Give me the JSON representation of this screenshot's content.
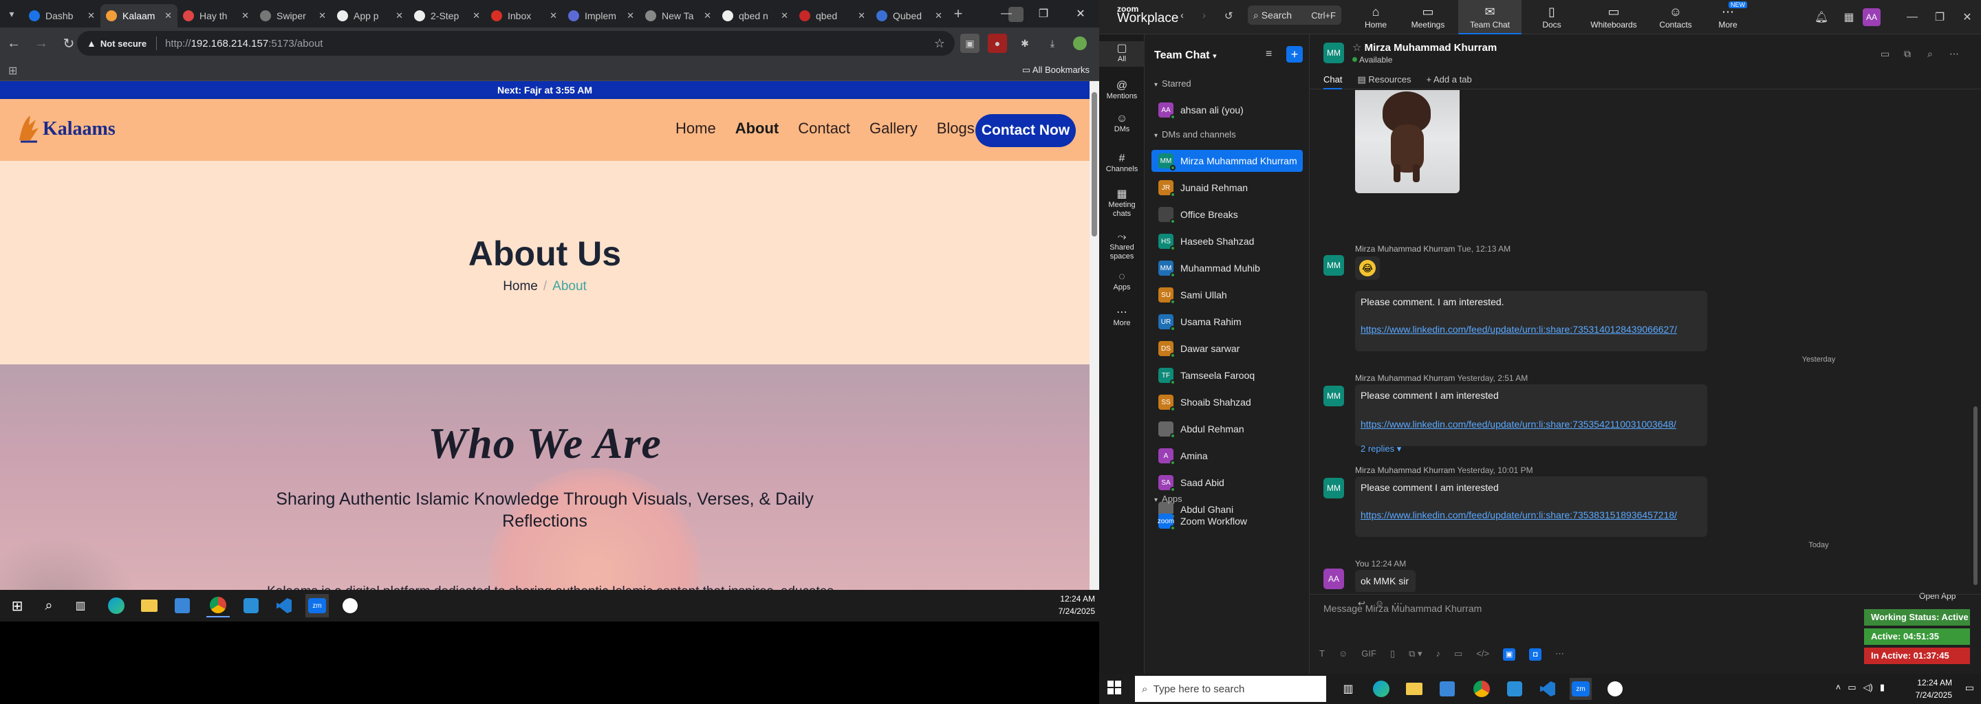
{
  "chrome": {
    "tabs": [
      {
        "label": "Dashb",
        "color": "#1a73e8"
      },
      {
        "label": "Kalaam",
        "color": "#f29d38",
        "active": true
      },
      {
        "label": "Hay th",
        "color": "#e04545"
      },
      {
        "label": "Swiper",
        "color": "#777777"
      },
      {
        "label": "App p",
        "color": "#eeeeee"
      },
      {
        "label": "2-Step",
        "color": "#eeeeee"
      },
      {
        "label": "Inbox",
        "color": "#d93025"
      },
      {
        "label": "Implem",
        "color": "#5b6bd6"
      },
      {
        "label": "New Ta",
        "color": "#888888"
      },
      {
        "label": "qbed n",
        "color": "#eeeeee"
      },
      {
        "label": "qbed",
        "color": "#c62828"
      },
      {
        "label": "Qubed",
        "color": "#3b6fd4"
      }
    ],
    "not_secure": "Not secure",
    "url_prefix": "http://",
    "url_host": "192.168.214.157",
    "url_suffix": ":5173/about",
    "all_bookmarks": "All Bookmarks"
  },
  "site": {
    "announcement": "Next: Fajr at 3:55 AM",
    "logo_text": "Kalaams",
    "nav": [
      "Home",
      "About",
      "Contact",
      "Gallery",
      "Blogs"
    ],
    "cta": "Contact Now",
    "hero_title": "About Us",
    "breadcrumb_home": "Home",
    "breadcrumb_sep": "/",
    "breadcrumb_current": "About",
    "who_title": "Who We Are",
    "who_subtitle": "Sharing Authentic Islamic Knowledge Through Visuals, Verses, & Daily Reflections",
    "who_body": "Kalaams is a digital platform dedicated to sharing authentic Islamic content that inspires, educates"
  },
  "left_taskbar": {
    "time": "12:24 AM",
    "date": "7/24/2025"
  },
  "zoom": {
    "logo_small": "zoom",
    "logo_big": "Workplace",
    "search_label": "Search",
    "search_shortcut": "Ctrl+F",
    "tabs": [
      {
        "label": "Home",
        "icon": "home-icon"
      },
      {
        "label": "Meetings",
        "icon": "meetings-icon"
      },
      {
        "label": "Team Chat",
        "icon": "chat-icon",
        "active": true
      },
      {
        "label": "Docs",
        "icon": "docs-icon"
      },
      {
        "label": "Whiteboards",
        "icon": "whiteboard-icon"
      },
      {
        "label": "Contacts",
        "icon": "contacts-icon"
      },
      {
        "label": "More",
        "icon": "more-icon",
        "badge": "NEW"
      }
    ],
    "avatar": "AA",
    "rail": [
      "All",
      "Mentions",
      "DMs",
      "Channels",
      "Meeting chats",
      "Shared spaces",
      "Apps",
      "More"
    ],
    "sidebar_title": "Team Chat",
    "section_starred": "Starred",
    "section_dms": "DMs and channels",
    "section_apps": "Apps",
    "starred": [
      {
        "initials": "AA",
        "name": "ahsan ali (you)",
        "color": "#9b3fb5"
      }
    ],
    "contacts": [
      {
        "initials": "MM",
        "name": "Mirza Muhammad Khurram",
        "color": "#0e8a78",
        "selected": true
      },
      {
        "initials": "JR",
        "name": "Junaid Rehman",
        "color": "#c77a1a"
      },
      {
        "initials": "",
        "name": "Office Breaks",
        "color": "#444444"
      },
      {
        "initials": "HS",
        "name": "Haseeb Shahzad",
        "color": "#0e8a78"
      },
      {
        "initials": "MM",
        "name": "Muhammad Muhib",
        "color": "#1f6fb5"
      },
      {
        "initials": "SU",
        "name": "Sami Ullah",
        "color": "#c77a1a"
      },
      {
        "initials": "UR",
        "name": "Usama Rahim",
        "color": "#1f6fb5"
      },
      {
        "initials": "DS",
        "name": "Dawar sarwar",
        "color": "#c77a1a"
      },
      {
        "initials": "TF",
        "name": "Tamseela Farooq",
        "color": "#0e8a78"
      },
      {
        "initials": "SS",
        "name": "Shoaib Shahzad",
        "color": "#c77a1a"
      },
      {
        "initials": "",
        "name": "Abdul Rehman",
        "color": "#666666"
      },
      {
        "initials": "A",
        "name": "Amina",
        "color": "#9b3fb5"
      },
      {
        "initials": "SA",
        "name": "Saad Abid",
        "color": "#9b3fb5"
      },
      {
        "initials": "",
        "name": "Abdul Ghani",
        "color": "#666666"
      }
    ],
    "apps": [
      {
        "initials": "zoom",
        "name": "Zoom Workflow",
        "color": "#0e72ed"
      }
    ],
    "chat_name": "Mirza Muhammad Khurram",
    "chat_status": "Available",
    "subtabs": [
      "Chat",
      "Resources",
      "Add a tab"
    ],
    "messages": [
      {
        "sender": "Mirza Muhammad Khurram",
        "time": "Tue, 12:13 AM"
      },
      {
        "text": "Please comment. I am interested.",
        "link": "https://www.linkedin.com/feed/update/urn:li:share:7353140128439066627/"
      },
      {
        "day": "Yesterday"
      },
      {
        "sender": "Mirza Muhammad Khurram",
        "time": "Yesterday, 2:51 AM",
        "text": "Please comment I am interested",
        "link": "https://www.linkedin.com/feed/update/urn:li:share:7353542110031003648/",
        "replies": "2 replies"
      },
      {
        "sender": "Mirza Muhammad Khurram",
        "time": "Yesterday, 10:01 PM",
        "text": "Please comment I am interested",
        "link": "https://www.linkedin.com/feed/update/urn:li:share:7353831518936457218/"
      },
      {
        "day": "Today"
      },
      {
        "sender": "You",
        "time": "12:24 AM",
        "text": "ok MMK sir"
      }
    ],
    "open_app": "Open App",
    "composer_placeholder": "Message Mirza Muhammad Khurram",
    "status_working": "Working Status: Active",
    "status_active": "Active: 04:51:35",
    "status_inactive": "In Active: 01:37:45"
  },
  "right_taskbar": {
    "search_placeholder": "Type here to search",
    "time": "12:24 AM",
    "date": "7/24/2025"
  }
}
